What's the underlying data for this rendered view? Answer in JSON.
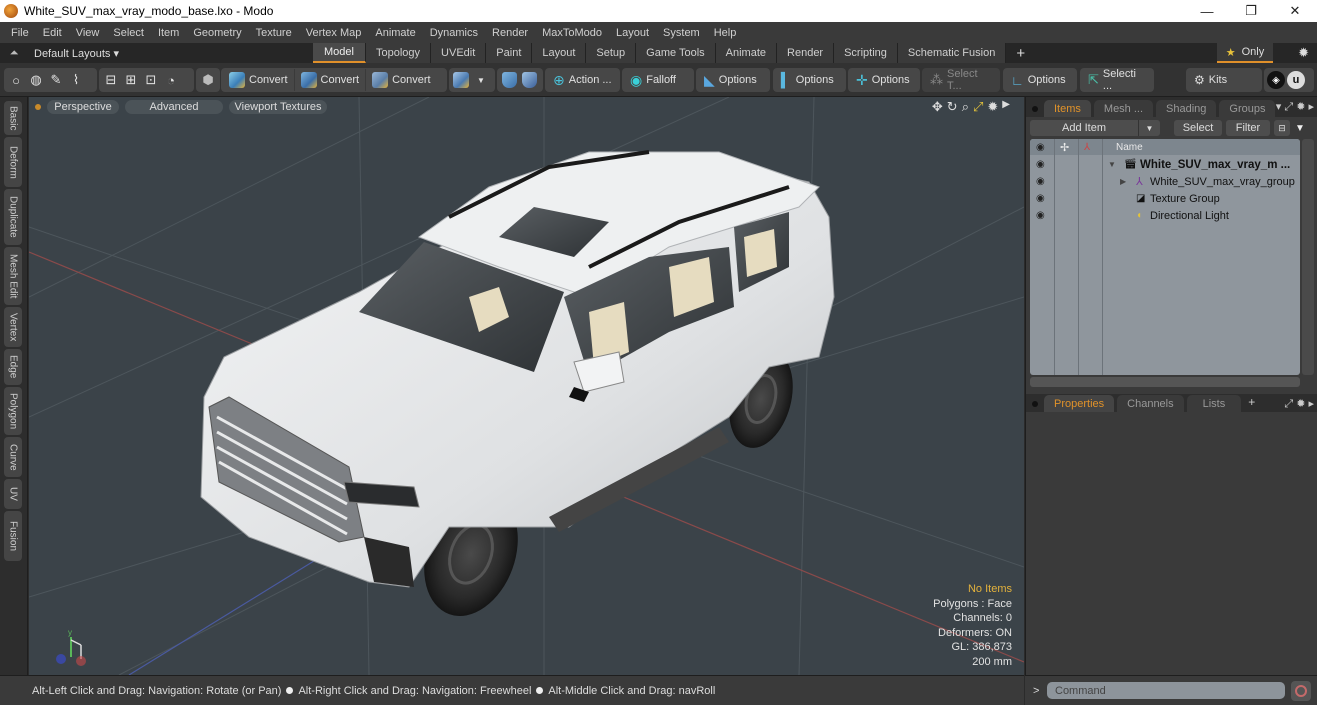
{
  "window": {
    "title": "White_SUV_max_vray_modo_base.lxo - Modo",
    "minimize": "—",
    "restore": "❐",
    "close": "✕"
  },
  "menubar": [
    "File",
    "Edit",
    "View",
    "Select",
    "Item",
    "Geometry",
    "Texture",
    "Vertex Map",
    "Animate",
    "Dynamics",
    "Render",
    "MaxToModo",
    "Layout",
    "System",
    "Help"
  ],
  "layoutbar": {
    "layouts_label": "Default Layouts ▾",
    "tabs": [
      "Model",
      "Topology",
      "UVEdit",
      "Paint",
      "Layout",
      "Setup",
      "Game Tools",
      "Animate",
      "Render",
      "Scripting",
      "Schematic Fusion"
    ],
    "active_tab": "Model",
    "add_tab": "+",
    "only_label": "Only",
    "accent_color": "#e0902a"
  },
  "toolbar": {
    "convert_1": "Convert",
    "convert_2": "Convert",
    "convert_3": "Convert",
    "action": "Action ...",
    "falloff": "Falloff",
    "options_1": "Options",
    "options_2": "Options",
    "options_3": "Options",
    "select_t": "Select T...",
    "options_4": "Options",
    "selecti": "Selecti ...",
    "kits": "Kits"
  },
  "left_tabs": [
    "Basic",
    "Deform",
    "Duplicate",
    "Mesh Edit",
    "Vertex",
    "Edge",
    "Polygon",
    "Curve",
    "UV",
    "Fusion"
  ],
  "viewport": {
    "view_mode": "Perspective",
    "shading": "Advanced",
    "textures": "Viewport Textures",
    "info": {
      "selection": "No Items",
      "polygons": "Polygons : Face",
      "channels": "Channels: 0",
      "deformers": "Deformers: ON",
      "gl": "GL: 386,873",
      "scale": "200 mm"
    }
  },
  "statusbar": {
    "hint1": "Alt-Left Click and Drag: Navigation: Rotate (or Pan)",
    "hint2": "Alt-Right Click and Drag: Navigation: Freewheel",
    "hint3": "Alt-Middle Click and Drag: navRoll"
  },
  "right_panel": {
    "tabs": [
      "Items",
      "Mesh ...",
      "Shading",
      "Groups"
    ],
    "active_tab": "Items",
    "add_item": "Add Item",
    "select": "Select",
    "filter": "Filter",
    "name_header": "Name",
    "tree": [
      {
        "label": "White_SUV_max_vray_m ...",
        "bold": true,
        "expander": "▼"
      },
      {
        "label": "White_SUV_max_vray_group",
        "bold": false,
        "expander": "▶"
      },
      {
        "label": "Texture Group",
        "bold": false,
        "expander": ""
      },
      {
        "label": "Directional Light",
        "bold": false,
        "expander": ""
      }
    ],
    "props_tabs": [
      "Properties",
      "Channels",
      "Lists"
    ],
    "props_active": "Properties",
    "props_add": "+"
  },
  "command": {
    "prompt": ">",
    "placeholder": "Command"
  }
}
